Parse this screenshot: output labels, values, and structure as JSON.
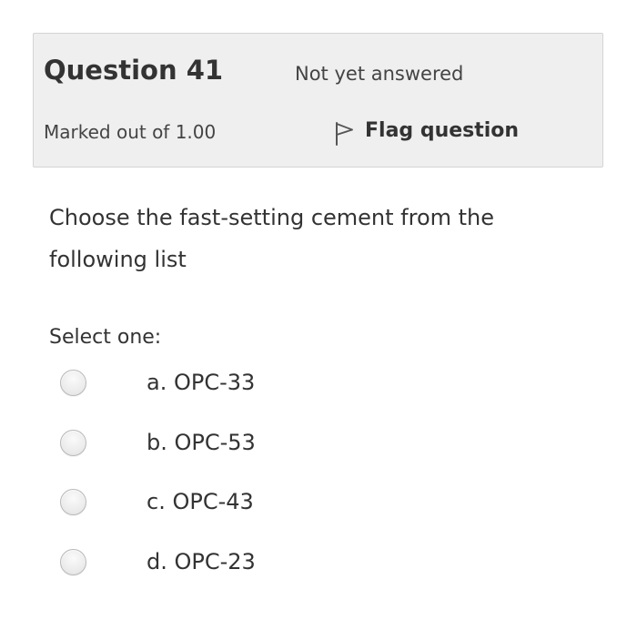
{
  "question": {
    "number_label": "Question 41",
    "state": "Not yet answered",
    "grade": "Marked out of 1.00",
    "flag_label": "Flag question",
    "text": "Choose the fast-setting cement from the following list",
    "prompt": "Select one:",
    "options": [
      {
        "label": "a. OPC-33",
        "selected": false
      },
      {
        "label": "b. OPC-53",
        "selected": false
      },
      {
        "label": "c. OPC-43",
        "selected": false
      },
      {
        "label": "d. OPC-23",
        "selected": false
      }
    ]
  },
  "icons": {
    "flag": "flag-outline-icon",
    "radio": "radio-unchecked-icon"
  },
  "colors": {
    "info_background": "#efefef",
    "info_border": "#d4d4d4",
    "text": "#333333"
  }
}
